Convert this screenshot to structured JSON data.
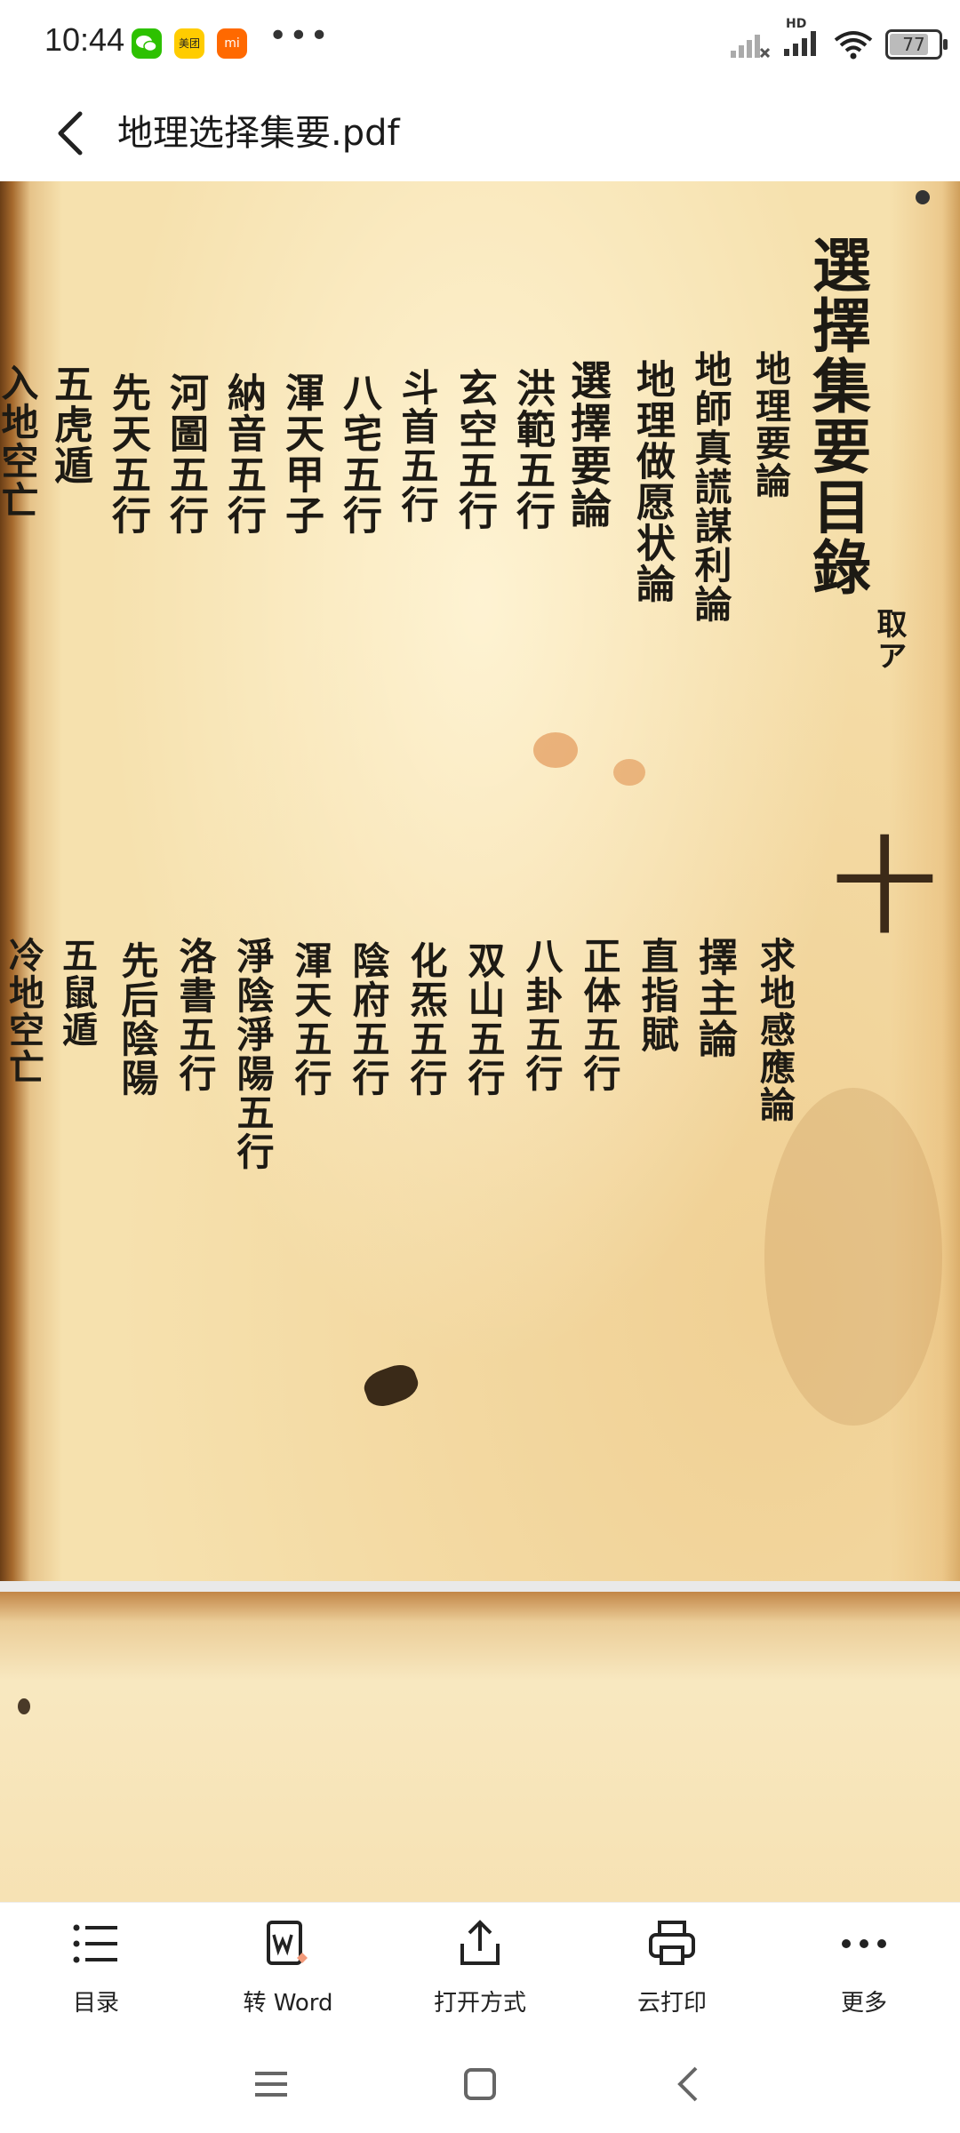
{
  "status_bar": {
    "time": "10:44",
    "apps": [
      "wechat-icon",
      "meituan-icon",
      "mi-icon"
    ],
    "meituan_text": "美团",
    "mi_text": "mi",
    "more": "•••",
    "hd": "HD",
    "battery": "77",
    "battery_level_percent": 77
  },
  "header": {
    "title": "地理选择集要.pdf"
  },
  "document": {
    "page1_title": "選擇集要目錄",
    "page1_title_note": "取ア",
    "upper_columns": [
      "地理要論",
      "地師真謊謀利論",
      "地理做愿状論",
      "選擇要論",
      "洪範五行",
      "玄空五行",
      "斗首五行",
      "八宅五行",
      "渾天甲子",
      "納音五行",
      "河圖五行",
      "先天五行",
      "五虎遁",
      "入地空亡"
    ],
    "lower_columns": [
      "求地感應論",
      "擇主論",
      "直指賦",
      "正体五行",
      "八卦五行",
      "双山五行",
      "化炁五行",
      "陰府五行",
      "渾天五行",
      "淨陰淨陽五行",
      "洛書五行",
      "先后陰陽",
      "五鼠遁",
      "冷地空亡"
    ],
    "margin_mark": "十"
  },
  "toolbar": {
    "items": [
      {
        "label": "目录",
        "icon": "list-icon"
      },
      {
        "label": "转 Word",
        "icon": "convert-word-icon"
      },
      {
        "label": "打开方式",
        "icon": "share-icon"
      },
      {
        "label": "云打印",
        "icon": "printer-icon"
      },
      {
        "label": "更多",
        "icon": "more-icon"
      }
    ]
  },
  "navbar": {
    "items": [
      "menu-icon",
      "home-icon",
      "back-icon"
    ]
  },
  "colors": {
    "paper": "#f4dca7",
    "ink": "#1d1a14",
    "wechat": "#2dc100",
    "mi": "#ff6900",
    "meituan": "#ffcc00"
  }
}
